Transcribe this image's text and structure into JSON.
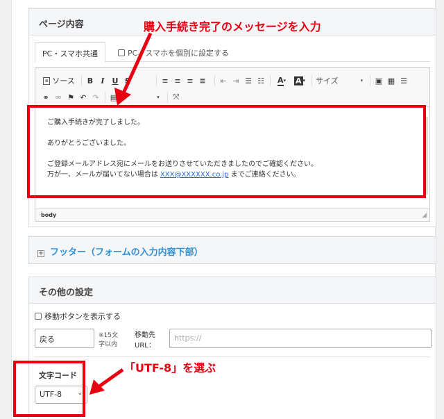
{
  "page_content": {
    "title": "ページ内容",
    "tabs": {
      "active": "PC・スマホ共通",
      "inactive": "PC、スマホを個別に設定する"
    },
    "toolbar": {
      "source": "ソース",
      "size": "サイズ"
    },
    "body_lines": [
      "ご購入手続きが完了しました。",
      "ありがとうございました。",
      "ご登録メールアドレス宛にメールをお送りさせていただきましたのでご確認ください。"
    ],
    "last_line": {
      "before": "万が一、メールが届いてない場合は ",
      "link": "XXX@XXXXXX.co.jp",
      "after": " までご連絡ください。"
    },
    "status": "body"
  },
  "annotations": {
    "top": "購入手続き完了のメッセージを入力",
    "bottom": "「UTF-8」を選ぶ",
    "color": "#e60012"
  },
  "footer_panel": {
    "title": "フッター（フォームの入力内容下部）"
  },
  "other_settings": {
    "title": "その他の設定",
    "move_button_checkbox": "移動ボタンを表示する",
    "back_value": "戻る",
    "char_note_1": "※15文",
    "char_note_2": "字以内",
    "dest_label_1": "移動先",
    "dest_label_2": "URL：",
    "url_placeholder": "https://",
    "charset_label": "文字コード",
    "charset_value": "UTF-8"
  }
}
